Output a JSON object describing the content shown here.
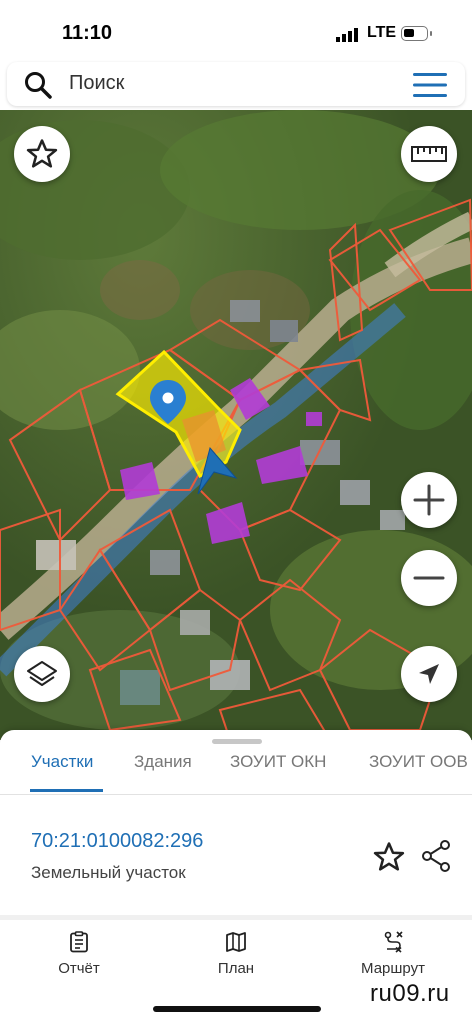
{
  "status_bar": {
    "time": "11:10",
    "network": "LTE",
    "icons": [
      "signal-icon",
      "battery-icon"
    ]
  },
  "search": {
    "placeholder": "Поиск",
    "icons": [
      "search-icon",
      "menu-icon"
    ]
  },
  "map": {
    "controls": [
      "star-icon",
      "ruler-icon",
      "zoom-in-icon",
      "zoom-out-icon",
      "layers-icon",
      "locate-arrow-icon"
    ],
    "colors": {
      "parcel_border": "#f05a3a",
      "selected_parcel": "#ffee00",
      "building_marker": "#b23cd6",
      "road_overlay": "#3f7fd6",
      "pin": "#2a7fd1"
    }
  },
  "sheet": {
    "tabs": [
      {
        "label": "Участки",
        "active": true
      },
      {
        "label": "Здания",
        "active": false
      },
      {
        "label": "ЗОУИТ ОКН",
        "active": false
      },
      {
        "label": "ЗОУИТ ООВ",
        "active": false
      }
    ],
    "parcel": {
      "id": "70:21:0100082:296",
      "type": "Земельный участок"
    }
  },
  "bottom_nav": {
    "items": [
      {
        "label": "Отчёт",
        "icon": "report-icon"
      },
      {
        "label": "План",
        "icon": "map-plan-icon"
      },
      {
        "label": "Маршрут",
        "icon": "route-icon"
      }
    ]
  },
  "watermark": "ru09.ru",
  "accent_color": "#1f6fb5"
}
